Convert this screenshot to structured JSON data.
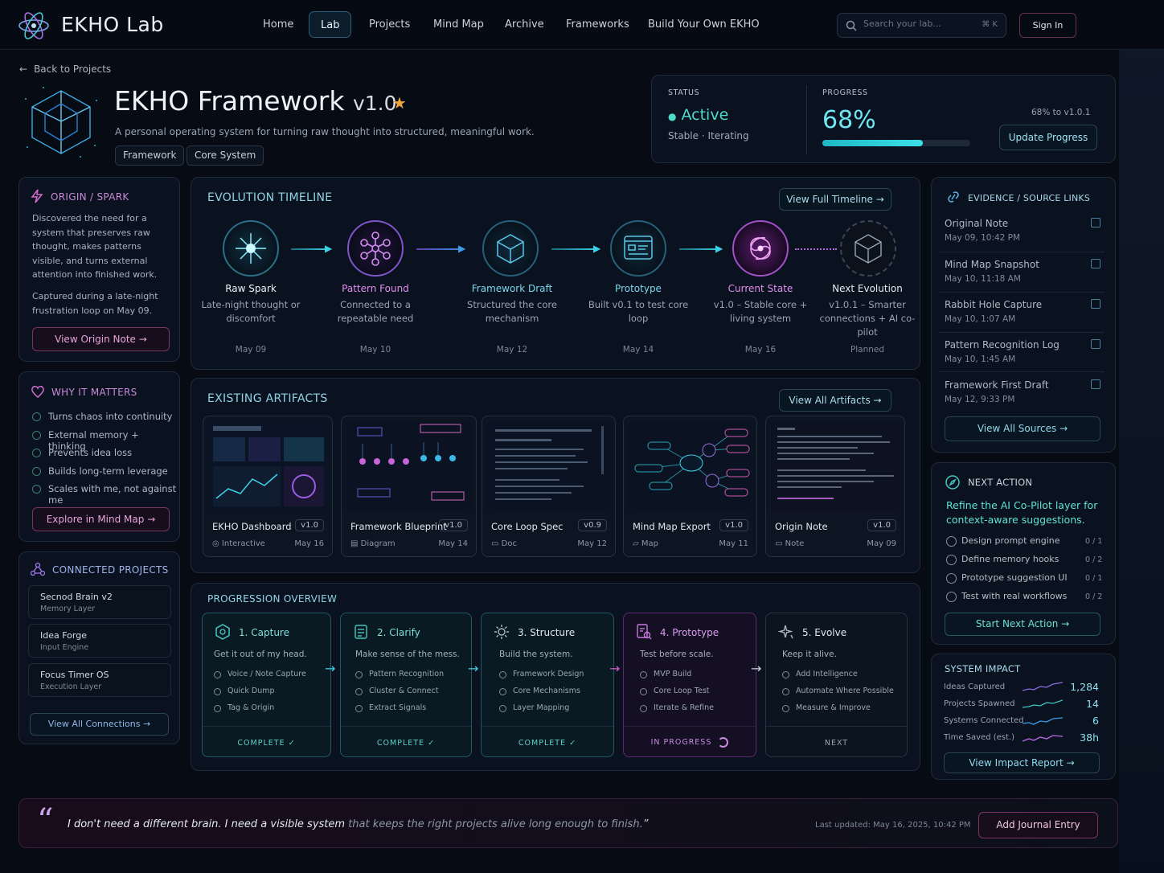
{
  "app": {
    "name": "EKHO Lab"
  },
  "nav": [
    "Home",
    "Lab",
    "Projects",
    "Mind Map",
    "Archive",
    "Frameworks",
    "Build Your Own EKHO"
  ],
  "search": {
    "placeholder": "Search your lab...",
    "shortcut": "⌘ K"
  },
  "signin": "Sign In",
  "back": "Back to Projects",
  "header": {
    "title": "EKHO Framework",
    "version": "v1.0",
    "subtitle": "A personal operating system for turning raw thought into structured, meaningful work.",
    "tags": [
      "Framework",
      "Core System"
    ]
  },
  "status": {
    "label": "STATUS",
    "value": "Active",
    "sub1": "Stable",
    "sub2": "Iterating",
    "progress_label": "PROGRESS",
    "progress_text": "68%",
    "progress_value": 0.68,
    "progress_target": "68% to v1.0.1",
    "update_button": "Update Progress"
  },
  "origin": {
    "title": "ORIGIN / SPARK",
    "text1": "Discovered the need for a system that preserves raw thought, makes patterns visible, and turns external attention into finished work.",
    "text2": "Captured during a late-night frustration loop on May 09.",
    "button": "View Origin Note"
  },
  "why": {
    "title": "WHY IT MATTERS",
    "items": [
      "Turns chaos into continuity",
      "External memory + thinking",
      "Prevents idea loss",
      "Builds long-term leverage",
      "Scales with me, not against me"
    ],
    "button": "Explore in Mind Map"
  },
  "connected": {
    "title": "CONNECTED PROJECTS",
    "items": [
      {
        "name": "Secnod Brain v2",
        "sub": "Memory Layer"
      },
      {
        "name": "Idea Forge",
        "sub": "Input Engine"
      },
      {
        "name": "Focus Timer OS",
        "sub": "Execution Layer"
      }
    ],
    "button": "View All Connections"
  },
  "timeline": {
    "title": "EVOLUTION TIMELINE",
    "button": "View Full Timeline",
    "steps": [
      {
        "name": "Raw Spark",
        "desc": "Late-night thought or discomfort",
        "date": "May 09"
      },
      {
        "name": "Pattern Found",
        "desc": "Connected to a repeatable need",
        "date": "May 10"
      },
      {
        "name": "Framework Draft",
        "desc": "Structured the core mechanism",
        "date": "May 12"
      },
      {
        "name": "Prototype",
        "desc": "Built v0.1 to test core loop",
        "date": "May 14"
      },
      {
        "name": "Current State",
        "desc": "v1.0 – Stable core + living system",
        "date": "May 16"
      },
      {
        "name": "Next Evolution",
        "desc": "v1.0.1 – Smarter connections + AI co-pilot",
        "date": "Planned"
      }
    ]
  },
  "artifacts": {
    "title": "EXISTING ARTIFACTS",
    "button": "View All Artifacts",
    "items": [
      {
        "name": "EKHO Dashboard",
        "version": "v1.0",
        "type": "Interactive",
        "date": "May 16"
      },
      {
        "name": "Framework Blueprint",
        "version": "v1.0",
        "type": "Diagram",
        "date": "May 14"
      },
      {
        "name": "Core Loop Spec",
        "version": "v0.9",
        "type": "Doc",
        "date": "May 12"
      },
      {
        "name": "Mind Map Export",
        "version": "v1.0",
        "type": "Map",
        "date": "May 11"
      },
      {
        "name": "Origin Note",
        "version": "v1.0",
        "type": "Note",
        "date": "May 09"
      }
    ]
  },
  "progression": {
    "title": "PROGRESSION OVERVIEW",
    "stages": [
      {
        "name": "1. Capture",
        "sub": "Get it out of my head.",
        "items": [
          "Voice / Note Capture",
          "Quick Dump",
          "Tag & Origin"
        ],
        "status": "COMPLETE"
      },
      {
        "name": "2. Clarify",
        "sub": "Make sense of the mess.",
        "items": [
          "Pattern Recognition",
          "Cluster & Connect",
          "Extract Signals"
        ],
        "status": "COMPLETE"
      },
      {
        "name": "3. Structure",
        "sub": "Build the system.",
        "items": [
          "Framework Design",
          "Core Mechanisms",
          "Layer Mapping"
        ],
        "status": "COMPLETE"
      },
      {
        "name": "4. Prototype",
        "sub": "Test before scale.",
        "items": [
          "MVP Build",
          "Core Loop Test",
          "Iterate & Refine"
        ],
        "status": "IN PROGRESS"
      },
      {
        "name": "5. Evolve",
        "sub": "Keep it alive.",
        "items": [
          "Add Intelligence",
          "Automate Where Possible",
          "Measure & Improve"
        ],
        "status": "NEXT"
      }
    ]
  },
  "sources": {
    "title": "EVIDENCE / SOURCE LINKS",
    "items": [
      {
        "name": "Original Note",
        "date": "May 09, 10:42 PM"
      },
      {
        "name": "Mind Map Snapshot",
        "date": "May 10, 11:18 AM"
      },
      {
        "name": "Rabbit Hole Capture",
        "date": "May 10, 1:07 AM"
      },
      {
        "name": "Pattern Recognition Log",
        "date": "May 10, 1:45 AM"
      },
      {
        "name": "Framework First Draft",
        "date": "May 12, 9:33 PM"
      }
    ],
    "button": "View All Sources"
  },
  "next_action": {
    "title": "NEXT ACTION",
    "headline": "Refine the AI Co-Pilot layer for context-aware suggestions.",
    "items": [
      {
        "label": "Design prompt engine",
        "count": "0 / 1"
      },
      {
        "label": "Define memory hooks",
        "count": "0 / 2"
      },
      {
        "label": "Prototype suggestion UI",
        "count": "0 / 1"
      },
      {
        "label": "Test with real workflows",
        "count": "0 / 2"
      }
    ],
    "button": "Start Next Action"
  },
  "impact": {
    "title": "SYSTEM IMPACT",
    "items": [
      {
        "label": "Ideas Captured",
        "value": "1,284"
      },
      {
        "label": "Projects Spawned",
        "value": "14"
      },
      {
        "label": "Systems Connected",
        "value": "6"
      },
      {
        "label": "Time Saved (est.)",
        "value": "38h"
      }
    ],
    "button": "View Impact Report"
  },
  "quote": {
    "part1": "I don't",
    "part2": "need a different brain. I need a visible system",
    "part3": "that keeps the right projects alive long enough to finish.",
    "updated_label": "Last updated:",
    "updated_value": "May 16, 2025, 10:42 PM",
    "button": "Add Journal Entry"
  },
  "colors": {
    "accent": "#35c7d6",
    "pink": "#c565c0",
    "purple": "#9a6ee0",
    "bg": "#060b14"
  }
}
